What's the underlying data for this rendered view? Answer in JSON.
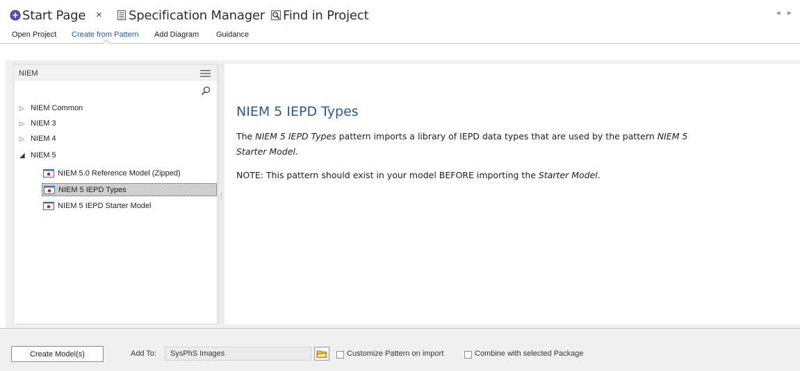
{
  "tabs": [
    {
      "label": "Start Page",
      "icon": "start-page-icon",
      "active": true,
      "closable": true
    },
    {
      "label": "Specification Manager",
      "icon": "specification-manager-icon",
      "active": false
    },
    {
      "label": "Find in Project",
      "icon": "find-in-project-icon",
      "active": false
    }
  ],
  "tab_close_glyph": "×",
  "menu": {
    "items": [
      "Open Project",
      "Create from Pattern",
      "Add Diagram",
      "Guidance"
    ],
    "active": "Create from Pattern"
  },
  "tree": {
    "title": "NIEM",
    "groups": [
      {
        "label": "NIEM Common",
        "expanded": false
      },
      {
        "label": "NIEM 3",
        "expanded": false
      },
      {
        "label": "NIEM 4",
        "expanded": false
      },
      {
        "label": "NIEM 5",
        "expanded": true
      }
    ],
    "leaves": [
      {
        "label": "NIEM 5.0 Reference Model (Zipped)",
        "selected": false
      },
      {
        "label": "NIEM 5 IEPD Types",
        "selected": true
      },
      {
        "label": "NIEM 5 IEPD Starter Model",
        "selected": false
      }
    ]
  },
  "description": {
    "title": "NIEM 5 IEPD Types",
    "p1_pre": "The ",
    "p1_italic1": "NIEM 5 IEPD Types",
    "p1_mid": " pattern imports a library of IEPD data types that are used by the pattern ",
    "p1_italic2a": "NIEM 5",
    "p1_italic2b": "Starter Model",
    "p1_end": ".",
    "p2_pre": "NOTE:  This pattern should exist in your model BEFORE importing the ",
    "p2_italic": "Starter Model",
    "p2_end": "."
  },
  "footer": {
    "create_button": "Create Model(s)",
    "add_to_label": "Add To:",
    "add_to_value": "SysPhS Images",
    "customize_label": "Customize Pattern on import",
    "customize_checked": false,
    "combine_label": "Combine with selected Package",
    "combine_checked": false
  },
  "colors": {
    "title_blue": "#2b579a",
    "menu_active": "#1f5f9f",
    "selection": "#cfcfcf",
    "panel_bg": "#f0f0f0"
  }
}
